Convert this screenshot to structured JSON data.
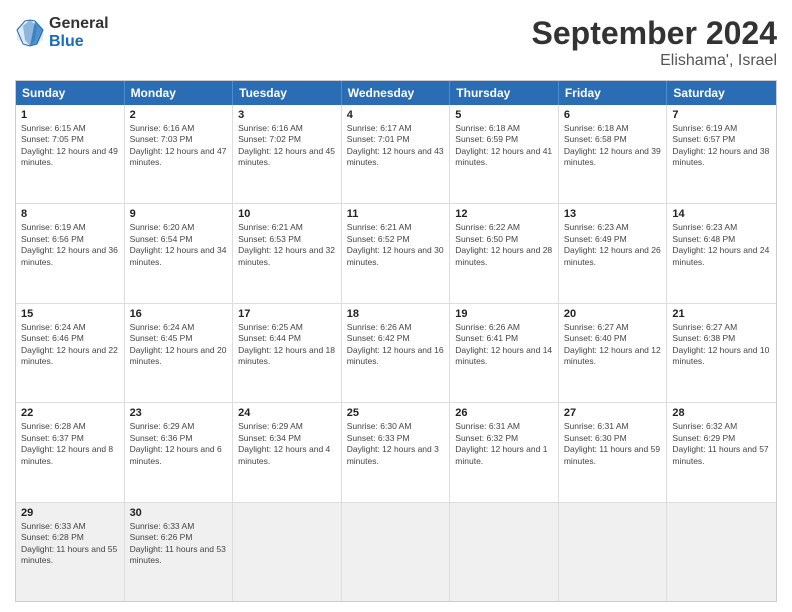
{
  "logo": {
    "general": "General",
    "blue": "Blue"
  },
  "header": {
    "title": "September 2024",
    "subtitle": "Elishama', Israel"
  },
  "days": [
    "Sunday",
    "Monday",
    "Tuesday",
    "Wednesday",
    "Thursday",
    "Friday",
    "Saturday"
  ],
  "weeks": [
    [
      {
        "day": "1",
        "sunrise": "6:15 AM",
        "sunset": "7:05 PM",
        "daylight": "12 hours and 49 minutes."
      },
      {
        "day": "2",
        "sunrise": "6:16 AM",
        "sunset": "7:03 PM",
        "daylight": "12 hours and 47 minutes."
      },
      {
        "day": "3",
        "sunrise": "6:16 AM",
        "sunset": "7:02 PM",
        "daylight": "12 hours and 45 minutes."
      },
      {
        "day": "4",
        "sunrise": "6:17 AM",
        "sunset": "7:01 PM",
        "daylight": "12 hours and 43 minutes."
      },
      {
        "day": "5",
        "sunrise": "6:18 AM",
        "sunset": "6:59 PM",
        "daylight": "12 hours and 41 minutes."
      },
      {
        "day": "6",
        "sunrise": "6:18 AM",
        "sunset": "6:58 PM",
        "daylight": "12 hours and 39 minutes."
      },
      {
        "day": "7",
        "sunrise": "6:19 AM",
        "sunset": "6:57 PM",
        "daylight": "12 hours and 38 minutes."
      }
    ],
    [
      {
        "day": "8",
        "sunrise": "6:19 AM",
        "sunset": "6:56 PM",
        "daylight": "12 hours and 36 minutes."
      },
      {
        "day": "9",
        "sunrise": "6:20 AM",
        "sunset": "6:54 PM",
        "daylight": "12 hours and 34 minutes."
      },
      {
        "day": "10",
        "sunrise": "6:21 AM",
        "sunset": "6:53 PM",
        "daylight": "12 hours and 32 minutes."
      },
      {
        "day": "11",
        "sunrise": "6:21 AM",
        "sunset": "6:52 PM",
        "daylight": "12 hours and 30 minutes."
      },
      {
        "day": "12",
        "sunrise": "6:22 AM",
        "sunset": "6:50 PM",
        "daylight": "12 hours and 28 minutes."
      },
      {
        "day": "13",
        "sunrise": "6:23 AM",
        "sunset": "6:49 PM",
        "daylight": "12 hours and 26 minutes."
      },
      {
        "day": "14",
        "sunrise": "6:23 AM",
        "sunset": "6:48 PM",
        "daylight": "12 hours and 24 minutes."
      }
    ],
    [
      {
        "day": "15",
        "sunrise": "6:24 AM",
        "sunset": "6:46 PM",
        "daylight": "12 hours and 22 minutes."
      },
      {
        "day": "16",
        "sunrise": "6:24 AM",
        "sunset": "6:45 PM",
        "daylight": "12 hours and 20 minutes."
      },
      {
        "day": "17",
        "sunrise": "6:25 AM",
        "sunset": "6:44 PM",
        "daylight": "12 hours and 18 minutes."
      },
      {
        "day": "18",
        "sunrise": "6:26 AM",
        "sunset": "6:42 PM",
        "daylight": "12 hours and 16 minutes."
      },
      {
        "day": "19",
        "sunrise": "6:26 AM",
        "sunset": "6:41 PM",
        "daylight": "12 hours and 14 minutes."
      },
      {
        "day": "20",
        "sunrise": "6:27 AM",
        "sunset": "6:40 PM",
        "daylight": "12 hours and 12 minutes."
      },
      {
        "day": "21",
        "sunrise": "6:27 AM",
        "sunset": "6:38 PM",
        "daylight": "12 hours and 10 minutes."
      }
    ],
    [
      {
        "day": "22",
        "sunrise": "6:28 AM",
        "sunset": "6:37 PM",
        "daylight": "12 hours and 8 minutes."
      },
      {
        "day": "23",
        "sunrise": "6:29 AM",
        "sunset": "6:36 PM",
        "daylight": "12 hours and 6 minutes."
      },
      {
        "day": "24",
        "sunrise": "6:29 AM",
        "sunset": "6:34 PM",
        "daylight": "12 hours and 4 minutes."
      },
      {
        "day": "25",
        "sunrise": "6:30 AM",
        "sunset": "6:33 PM",
        "daylight": "12 hours and 3 minutes."
      },
      {
        "day": "26",
        "sunrise": "6:31 AM",
        "sunset": "6:32 PM",
        "daylight": "12 hours and 1 minute."
      },
      {
        "day": "27",
        "sunrise": "6:31 AM",
        "sunset": "6:30 PM",
        "daylight": "11 hours and 59 minutes."
      },
      {
        "day": "28",
        "sunrise": "6:32 AM",
        "sunset": "6:29 PM",
        "daylight": "11 hours and 57 minutes."
      }
    ],
    [
      {
        "day": "29",
        "sunrise": "6:33 AM",
        "sunset": "6:28 PM",
        "daylight": "11 hours and 55 minutes."
      },
      {
        "day": "30",
        "sunrise": "6:33 AM",
        "sunset": "6:26 PM",
        "daylight": "11 hours and 53 minutes."
      },
      null,
      null,
      null,
      null,
      null
    ]
  ]
}
